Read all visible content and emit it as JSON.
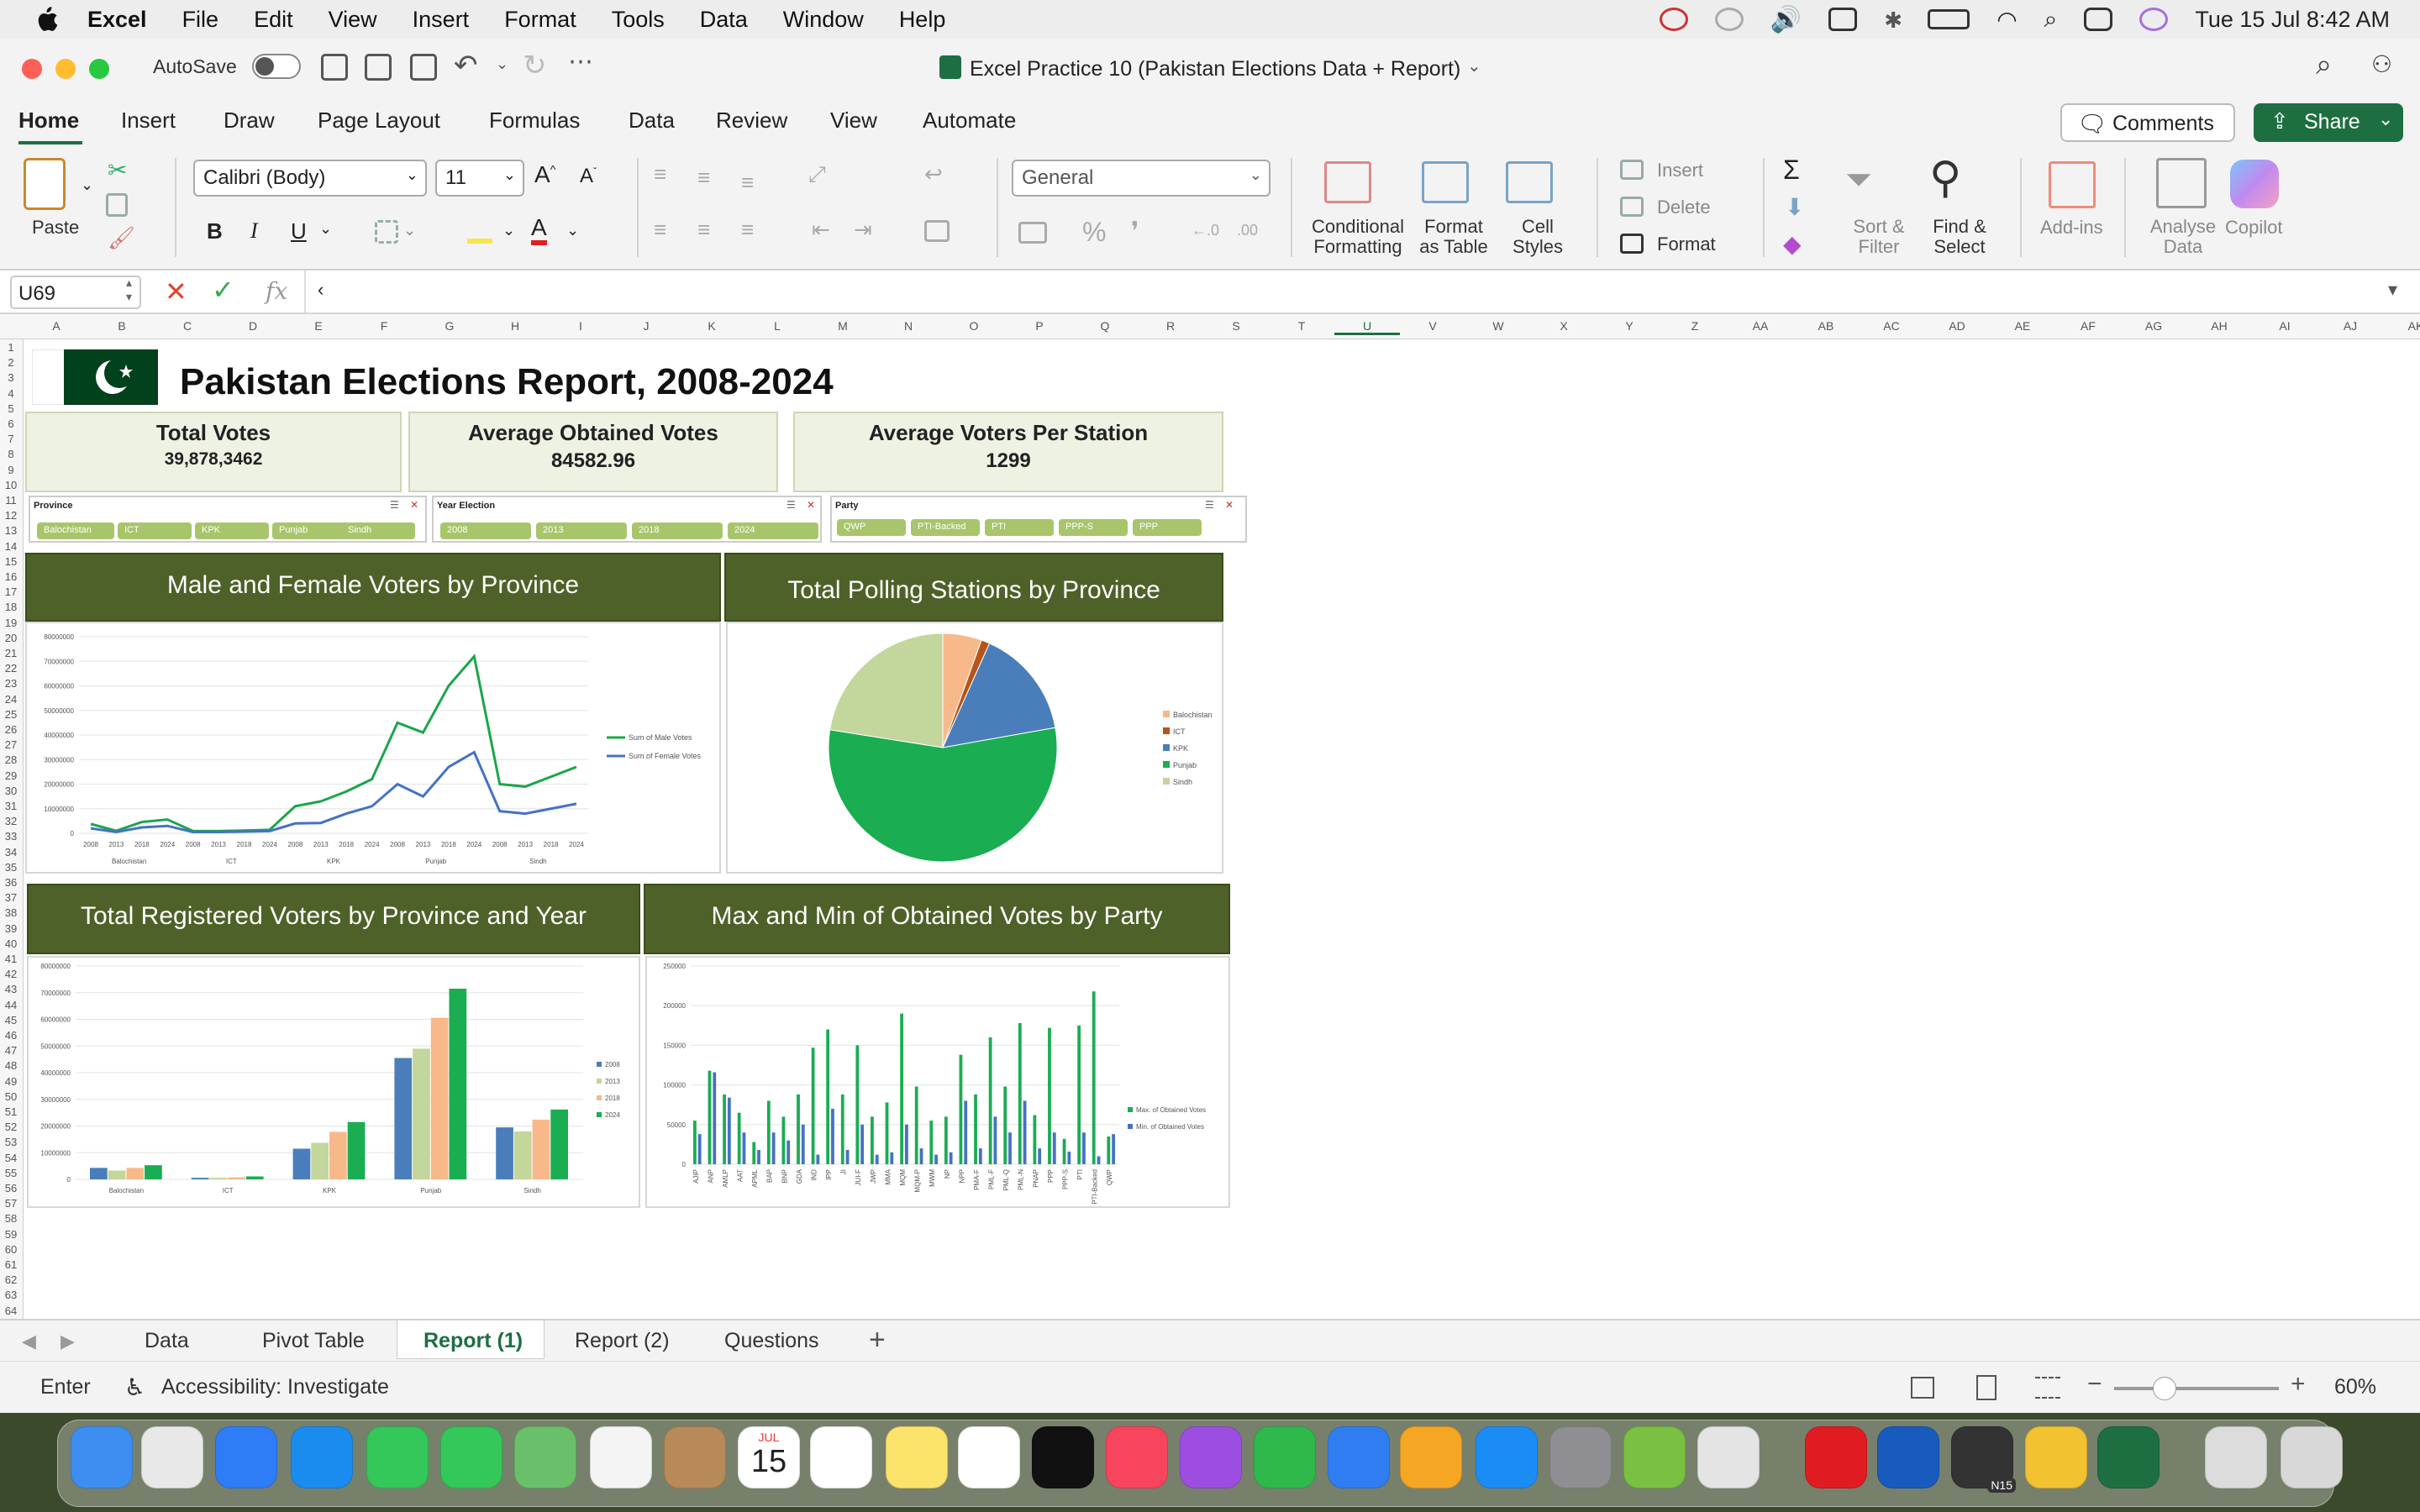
{
  "menubar": {
    "app": "Excel",
    "items": [
      "File",
      "Edit",
      "View",
      "Insert",
      "Format",
      "Tools",
      "Data",
      "Window",
      "Help"
    ],
    "clock": "Tue 15 Jul  8:42 AM"
  },
  "window": {
    "autosave_label": "AutoSave",
    "title": "Excel Practice 10 (Pakistan Elections Data + Report)"
  },
  "ribbon_tabs": [
    "Home",
    "Insert",
    "Draw",
    "Page Layout",
    "Formulas",
    "Data",
    "Review",
    "View",
    "Automate"
  ],
  "ribbon": {
    "comments": "Comments",
    "share": "Share",
    "paste": "Paste",
    "font_name": "Calibri (Body)",
    "font_size": "11",
    "number_format": "General",
    "conditional_formatting": [
      "Conditional",
      "Formatting"
    ],
    "format_as_table": [
      "Format",
      "as Table"
    ],
    "cell_styles": [
      "Cell",
      "Styles"
    ],
    "insert": "Insert",
    "delete": "Delete",
    "format": "Format",
    "sort_filter": [
      "Sort &",
      "Filter"
    ],
    "find_select": [
      "Find &",
      "Select"
    ],
    "addins": "Add-ins",
    "analyse_data": [
      "Analyse",
      "Data"
    ],
    "copilot": "Copilot"
  },
  "formula_bar": {
    "name_box": "U69",
    "fx": "fx",
    "content": "‹"
  },
  "columns": [
    "A",
    "B",
    "C",
    "D",
    "E",
    "F",
    "G",
    "H",
    "I",
    "J",
    "K",
    "L",
    "M",
    "N",
    "O",
    "P",
    "Q",
    "R",
    "S",
    "T",
    "U",
    "V",
    "W",
    "X",
    "Y",
    "Z",
    "AA",
    "AB",
    "AC",
    "AD",
    "AE",
    "AF",
    "AG",
    "AH",
    "AI",
    "AJ",
    "AK"
  ],
  "report": {
    "title": "Pakistan Elections Report, 2008-2024",
    "kpis": [
      {
        "label": "Total Votes",
        "value": "39,878,3462"
      },
      {
        "label": "Average Obtained Votes",
        "value": "84582.96"
      },
      {
        "label": "Average Voters Per Station",
        "value": "1299"
      }
    ],
    "slicers": [
      {
        "title": "Province",
        "items": [
          "Balochistan",
          "ICT",
          "KPK",
          "Punjab",
          "Sindh"
        ]
      },
      {
        "title": "Year Election",
        "items": [
          "2008",
          "2013",
          "2018",
          "2024"
        ]
      },
      {
        "title": "Party",
        "items": [
          "QWP",
          "PTI-Backed",
          "PTI",
          "PPP-S",
          "PPP"
        ]
      }
    ],
    "chart_titles": [
      "Male and Female Voters by Province",
      "Total Polling Stations by Province",
      "Total Registered Voters by Province and Year",
      "Max and Min of Obtained Votes by Party"
    ]
  },
  "chart_data": [
    {
      "type": "line",
      "title": "Male and Female Voters by Province",
      "years": [
        "2008",
        "2013",
        "2018",
        "2024"
      ],
      "groups": [
        "Balochistan",
        "ICT",
        "KPK",
        "Punjab",
        "Sindh"
      ],
      "ylim": [
        0,
        80000000
      ],
      "yticks": [
        "80000000",
        "70000000",
        "60000000",
        "50000000",
        "40000000",
        "30000000",
        "20000000",
        "10000000",
        "0"
      ],
      "series": [
        {
          "name": "Sum of Male Votes",
          "color": "#1aa64a",
          "values": [
            3800000,
            1000000,
            4600000,
            5600000,
            900000,
            900000,
            1100000,
            1400000,
            11000000,
            13000000,
            17000000,
            22000000,
            45000000,
            41000000,
            60000000,
            72000000,
            20000000,
            19000000,
            23000000,
            27000000
          ]
        },
        {
          "name": "Sum of Female Votes",
          "color": "#4472c4",
          "values": [
            2000000,
            500000,
            2400000,
            3000000,
            500000,
            500000,
            700000,
            900000,
            4000000,
            4200000,
            8000000,
            11000000,
            20000000,
            15000000,
            27000000,
            33000000,
            9000000,
            8000000,
            10000000,
            12000000
          ]
        }
      ],
      "legend": "right"
    },
    {
      "type": "pie",
      "title": "Total Polling Stations by Province",
      "categories": [
        "Balochistan",
        "ICT",
        "KPK",
        "Punjab",
        "Sindh"
      ],
      "values": [
        5.5,
        1.2,
        15.5,
        55.3,
        22.5
      ],
      "colors": [
        "#f8b98a",
        "#b5541c",
        "#4a7ebb",
        "#1aad52",
        "#c3d69b"
      ],
      "legend": "right"
    },
    {
      "type": "bar",
      "title": "Total Registered Voters by Province and Year",
      "categories": [
        "Balochistan",
        "ICT",
        "KPK",
        "Punjab",
        "Sindh"
      ],
      "ylim": [
        0,
        80000000
      ],
      "yticks": [
        "80000000",
        "70000000",
        "60000000",
        "50000000",
        "40000000",
        "30000000",
        "20000000",
        "10000000",
        "0"
      ],
      "series": [
        {
          "name": "2008",
          "color": "#4a7ebb",
          "values": [
            4300000,
            600000,
            11500000,
            45500000,
            19500000
          ]
        },
        {
          "name": "2013",
          "color": "#c3d69b",
          "values": [
            3300000,
            600000,
            13700000,
            49000000,
            18000000
          ]
        },
        {
          "name": "2018",
          "color": "#f8b98a",
          "values": [
            4300000,
            760000,
            17800000,
            60600000,
            22400000
          ]
        },
        {
          "name": "2024",
          "color": "#1aad52",
          "values": [
            5300000,
            1100000,
            21500000,
            71500000,
            26200000
          ]
        }
      ],
      "legend": "right"
    },
    {
      "type": "bar",
      "title": "Max and Min of Obtained Votes by Party",
      "categories": [
        "AJIP",
        "ANP",
        "AMLP",
        "AAT",
        "APML",
        "BAP",
        "BNP",
        "GDA",
        "IND",
        "IPP",
        "JI",
        "JUI-F",
        "JWP",
        "MMA",
        "MQM",
        "MQM-P",
        "MWM",
        "NP",
        "NPP",
        "PMA-F",
        "PML-F",
        "PML-Q",
        "PML-N",
        "PNAP",
        "PPP",
        "PPP-S",
        "PTI",
        "PTI-Backed",
        "QWP"
      ],
      "ylim": [
        0,
        250000
      ],
      "yticks": [
        "250000",
        "200000",
        "150000",
        "100000",
        "50000",
        "0"
      ],
      "series": [
        {
          "name": "Max. of Obtained Votes",
          "color": "#1aad52",
          "values": [
            55000,
            118000,
            88000,
            65000,
            28000,
            80000,
            60000,
            88000,
            147000,
            170000,
            88000,
            150000,
            60000,
            78000,
            190000,
            98000,
            55000,
            60000,
            138000,
            88000,
            160000,
            98000,
            178000,
            62000,
            172000,
            32000,
            175000,
            218000,
            35000
          ]
        },
        {
          "name": "Min. of Obtained Votes",
          "color": "#4472c4",
          "values": [
            38000,
            116000,
            84000,
            40000,
            18000,
            40000,
            30000,
            50000,
            12000,
            70000,
            18000,
            50000,
            12000,
            15000,
            50000,
            20000,
            12000,
            15000,
            80000,
            20000,
            60000,
            40000,
            80000,
            20000,
            40000,
            16000,
            40000,
            10000,
            38000
          ]
        }
      ],
      "legend": "right"
    }
  ],
  "sheet_tabs": [
    "Data",
    "Pivot Table",
    "Report (1)",
    "Report (2)",
    "Questions"
  ],
  "status": {
    "mode": "Enter",
    "accessibility": "Accessibility: Investigate",
    "zoom": "60%"
  },
  "calendar": {
    "month": "JUL",
    "day": "15"
  },
  "dock_badge": "N15"
}
